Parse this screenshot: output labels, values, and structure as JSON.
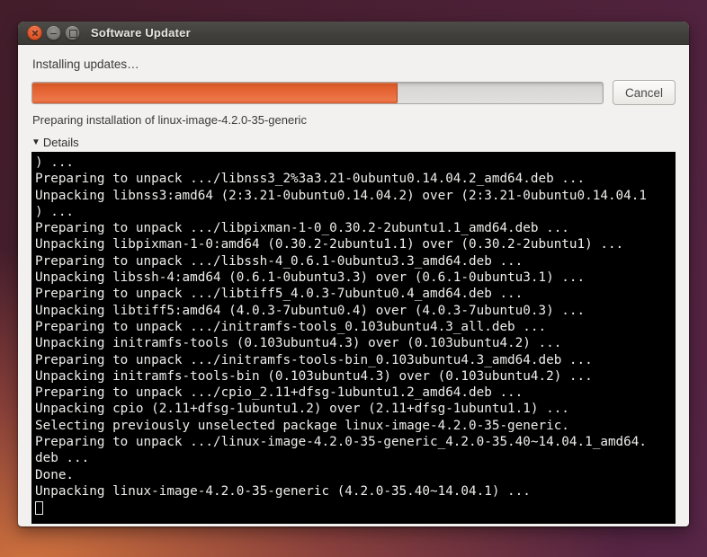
{
  "window": {
    "title": "Software Updater",
    "controls": {
      "close": "close",
      "minimize": "minimize",
      "maximize": "maximize"
    }
  },
  "main": {
    "heading": "Installing updates…",
    "progress": {
      "percent": 64,
      "fill_color": "#e8663a",
      "trough_color": "#dbd9d7"
    },
    "cancel_label": "Cancel",
    "status": "Preparing installation of linux-image-4.2.0-35-generic",
    "details": {
      "label": "Details",
      "expanded": true
    }
  },
  "icons": {
    "details_arrow": "▼"
  },
  "colors": {
    "titlebar": "#3c3b37",
    "window_bg": "#f2f1ef",
    "accent_orange": "#e8663a",
    "terminal_bg": "#000000",
    "terminal_fg": "#eeeeec"
  },
  "terminal": {
    "lines": [
      ") ...",
      "Preparing to unpack .../libnss3_2%3a3.21-0ubuntu0.14.04.2_amd64.deb ...",
      "Unpacking libnss3:amd64 (2:3.21-0ubuntu0.14.04.2) over (2:3.21-0ubuntu0.14.04.1",
      ") ...",
      "Preparing to unpack .../libpixman-1-0_0.30.2-2ubuntu1.1_amd64.deb ...",
      "Unpacking libpixman-1-0:amd64 (0.30.2-2ubuntu1.1) over (0.30.2-2ubuntu1) ...",
      "Preparing to unpack .../libssh-4_0.6.1-0ubuntu3.3_amd64.deb ...",
      "Unpacking libssh-4:amd64 (0.6.1-0ubuntu3.3) over (0.6.1-0ubuntu3.1) ...",
      "Preparing to unpack .../libtiff5_4.0.3-7ubuntu0.4_amd64.deb ...",
      "Unpacking libtiff5:amd64 (4.0.3-7ubuntu0.4) over (4.0.3-7ubuntu0.3) ...",
      "Preparing to unpack .../initramfs-tools_0.103ubuntu4.3_all.deb ...",
      "Unpacking initramfs-tools (0.103ubuntu4.3) over (0.103ubuntu4.2) ...",
      "Preparing to unpack .../initramfs-tools-bin_0.103ubuntu4.3_amd64.deb ...",
      "Unpacking initramfs-tools-bin (0.103ubuntu4.3) over (0.103ubuntu4.2) ...",
      "Preparing to unpack .../cpio_2.11+dfsg-1ubuntu1.2_amd64.deb ...",
      "Unpacking cpio (2.11+dfsg-1ubuntu1.2) over (2.11+dfsg-1ubuntu1.1) ...",
      "Selecting previously unselected package linux-image-4.2.0-35-generic.",
      "Preparing to unpack .../linux-image-4.2.0-35-generic_4.2.0-35.40~14.04.1_amd64.",
      "deb ...",
      "Done.",
      "Unpacking linux-image-4.2.0-35-generic (4.2.0-35.40~14.04.1) ..."
    ]
  }
}
